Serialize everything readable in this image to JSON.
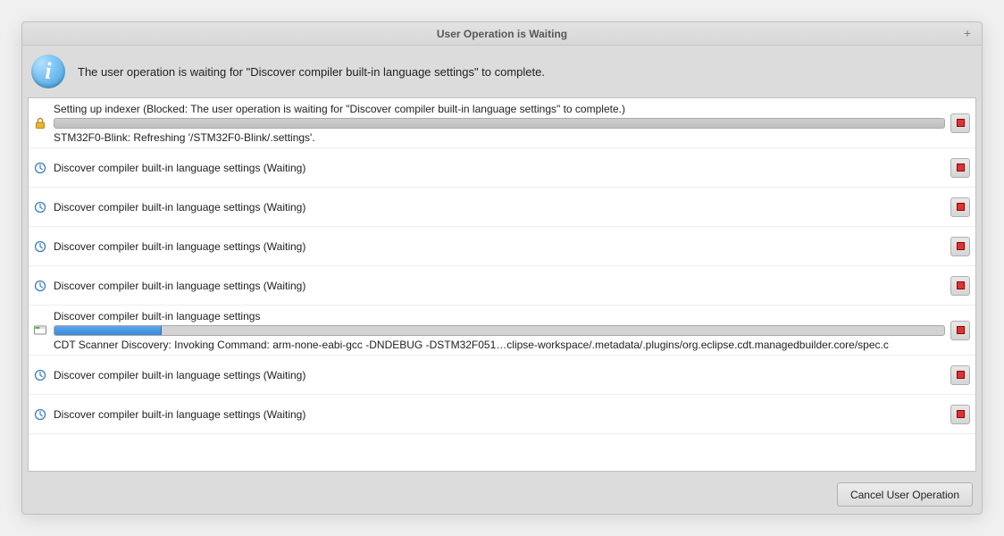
{
  "titlebar": {
    "title": "User Operation is Waiting"
  },
  "header": {
    "message": "The user operation is waiting for \"Discover compiler built-in language settings\" to complete."
  },
  "tasks": [
    {
      "kind": "blocked",
      "title": "Setting up indexer (Blocked: The user operation is waiting for \"Discover compiler built-in language settings\" to complete.)",
      "detail": "STM32F0-Blink: Refreshing '/STM32F0-Blink/.settings'."
    },
    {
      "kind": "waiting",
      "title": "Discover compiler built-in language settings (Waiting)"
    },
    {
      "kind": "waiting",
      "title": "Discover compiler built-in language settings (Waiting)"
    },
    {
      "kind": "waiting",
      "title": "Discover compiler built-in language settings (Waiting)"
    },
    {
      "kind": "waiting",
      "title": "Discover compiler built-in language settings (Waiting)"
    },
    {
      "kind": "active",
      "title": "Discover compiler built-in language settings",
      "detail": "CDT Scanner Discovery: Invoking Command: arm-none-eabi-gcc -DNDEBUG -DSTM32F051…clipse-workspace/.metadata/.plugins/org.eclipse.cdt.managedbuilder.core/spec.c",
      "progress_percent": 12
    },
    {
      "kind": "waiting",
      "title": "Discover compiler built-in language settings (Waiting)"
    },
    {
      "kind": "waiting",
      "title": "Discover compiler built-in language settings (Waiting)"
    }
  ],
  "buttons": {
    "cancel": "Cancel User Operation"
  },
  "icons": {
    "info": "i"
  }
}
